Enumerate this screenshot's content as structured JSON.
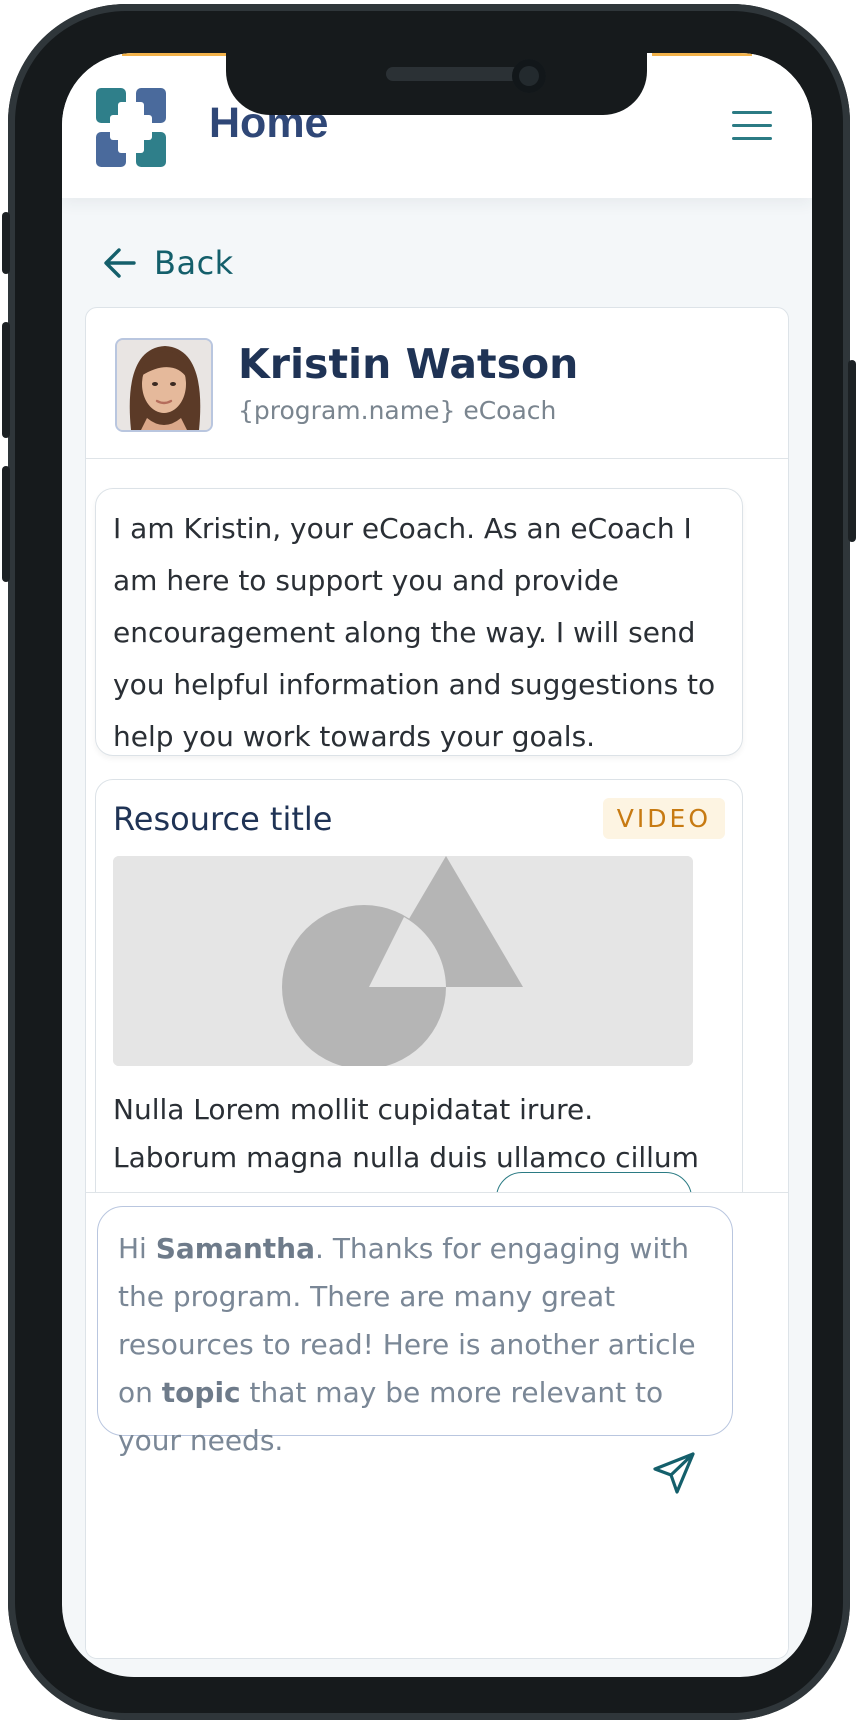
{
  "header": {
    "title": "Home"
  },
  "nav": {
    "back_label": "Back"
  },
  "coach": {
    "name": "Kristin Watson",
    "role": "{program.name} eCoach"
  },
  "intro_message": "I am Kristin, your eCoach. As an eCoach I am here to support you and provide encouragement along the way. I will send you helpful information and suggestions to help you work towards your goals.",
  "resource": {
    "title": "Resource title",
    "badge": "VIDEO",
    "description": "Nulla Lorem mollit cupidatat irure. Laborum magna nulla duis ullamco cillum dolor."
  },
  "composer": {
    "text_parts": [
      "Hi ",
      "Samantha",
      ". Thanks for engaging with the program. There are many great resources to read! Here is another article on ",
      "topic",
      " that may be more relevant to your needs."
    ]
  },
  "colors": {
    "brand_navy": "#2f4777",
    "brand_teal": "#2b7b84",
    "badge_orange": "#c77a12"
  },
  "icons": [
    "logo-icon",
    "menu-icon",
    "back-arrow-icon",
    "send-icon",
    "image-placeholder-icon"
  ]
}
